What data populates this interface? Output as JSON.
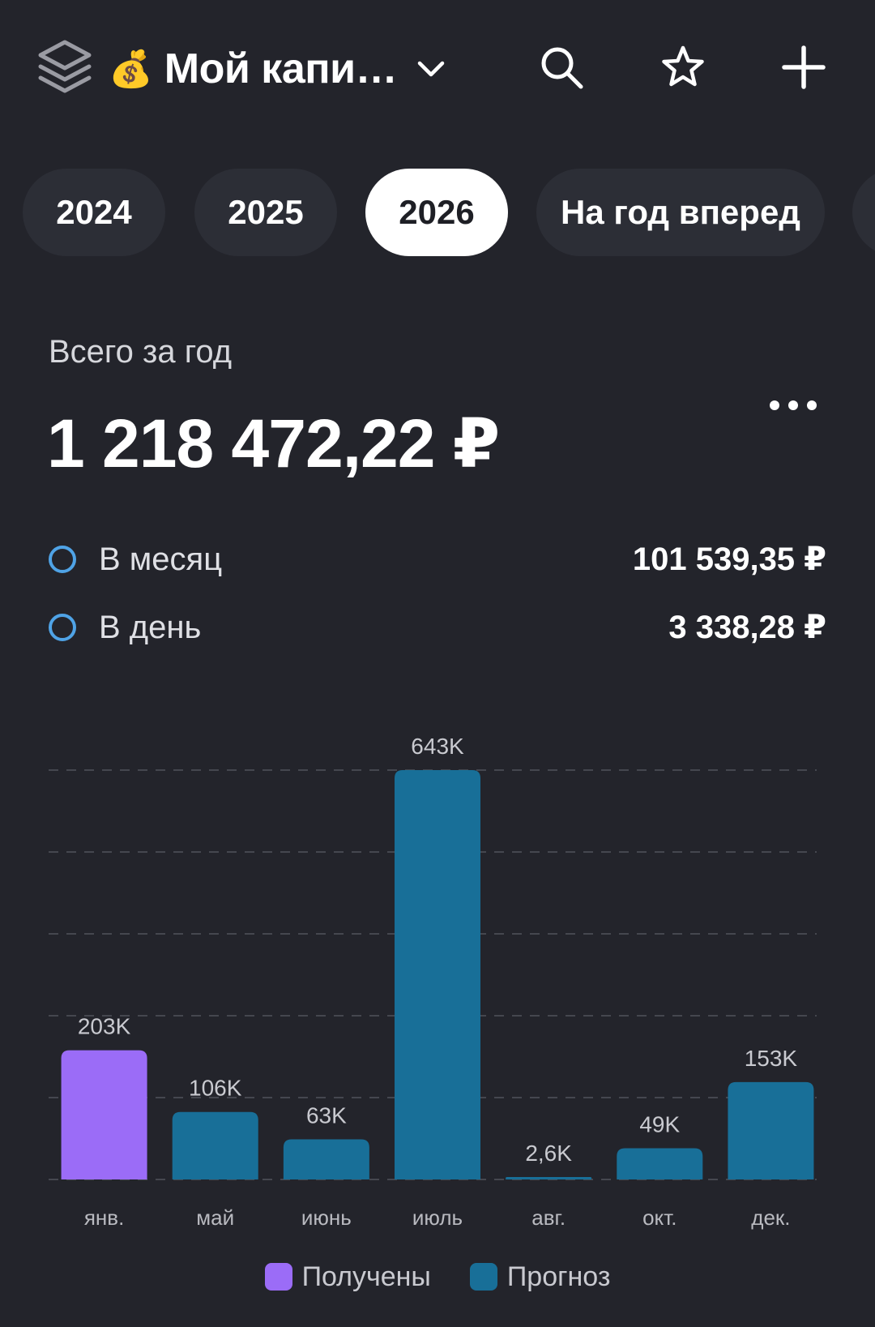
{
  "header": {
    "title_emoji": "💰",
    "title": "Мой капи…",
    "icons": [
      "layers-icon",
      "chevron-down-icon",
      "search-icon",
      "star-icon",
      "plus-icon"
    ]
  },
  "tabs": [
    {
      "label": "2024",
      "active": false
    },
    {
      "label": "2025",
      "active": false
    },
    {
      "label": "2026",
      "active": true
    },
    {
      "label": "На год вперед",
      "active": false
    }
  ],
  "summary": {
    "total_label": "Всего за год",
    "total_value": "1 218 472,22 ₽",
    "per_month_label": "В месяц",
    "per_month_value": "101 539,35 ₽",
    "per_day_label": "В день",
    "per_day_value": "3 338,28 ₽"
  },
  "colors": {
    "background": "#23242b",
    "received": "#9b6cf7",
    "forecast": "#186f98",
    "radio": "#4fa3e6",
    "tab_active_bg": "#ffffff",
    "tab_bg": "#2c2e36"
  },
  "chart_data": {
    "type": "bar",
    "categories": [
      "янв.",
      "май",
      "июнь",
      "июль",
      "авг.",
      "окт.",
      "дек."
    ],
    "values": [
      203000,
      106000,
      63000,
      643000,
      2600,
      49000,
      153000
    ],
    "value_labels": [
      "203K",
      "106K",
      "63K",
      "643K",
      "2,6K",
      "49K",
      "153K"
    ],
    "series_of_bar": [
      "Получены",
      "Прогноз",
      "Прогноз",
      "Прогноз",
      "Прогноз",
      "Прогноз",
      "Прогноз"
    ],
    "ylim": [
      0,
      643000
    ],
    "grid": true,
    "legend": [
      "Получены",
      "Прогноз"
    ],
    "legend_position": "bottom"
  }
}
